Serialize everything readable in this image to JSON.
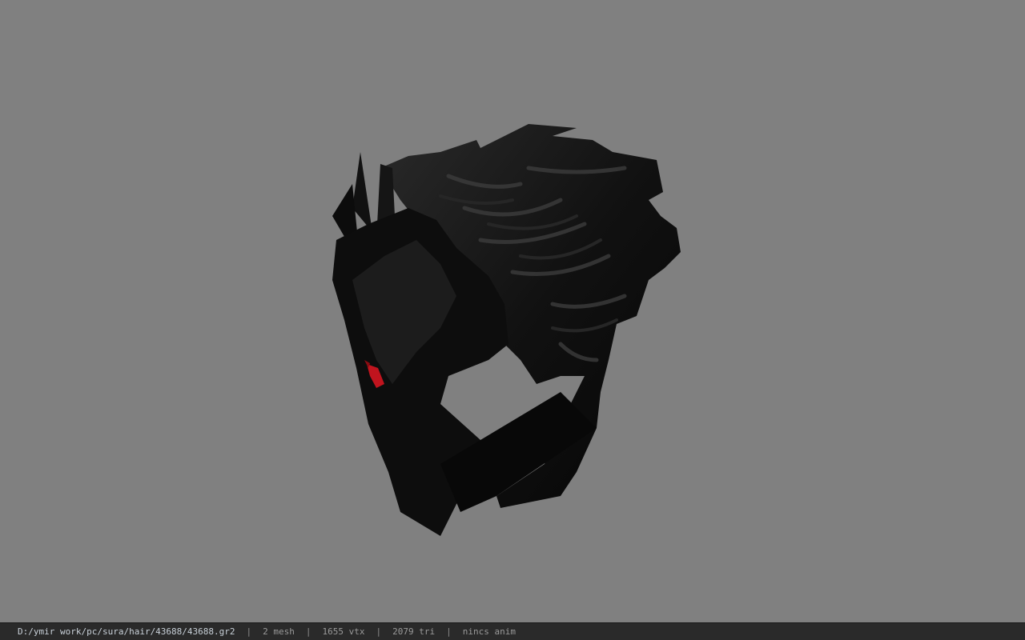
{
  "viewer": {
    "model_name": "hair mesh",
    "background_color": "#808080",
    "model_color": "#0a0a0a",
    "eye_color": "#c0141e"
  },
  "status": {
    "file_path": "D:/ymir work/pc/sura/hair/43688/43688.gr2",
    "separator": "|",
    "mesh_count": "2 mesh",
    "vertex_count": "1655 vtx",
    "triangle_count": "2079 tri",
    "anim_status": "nincs anim"
  }
}
